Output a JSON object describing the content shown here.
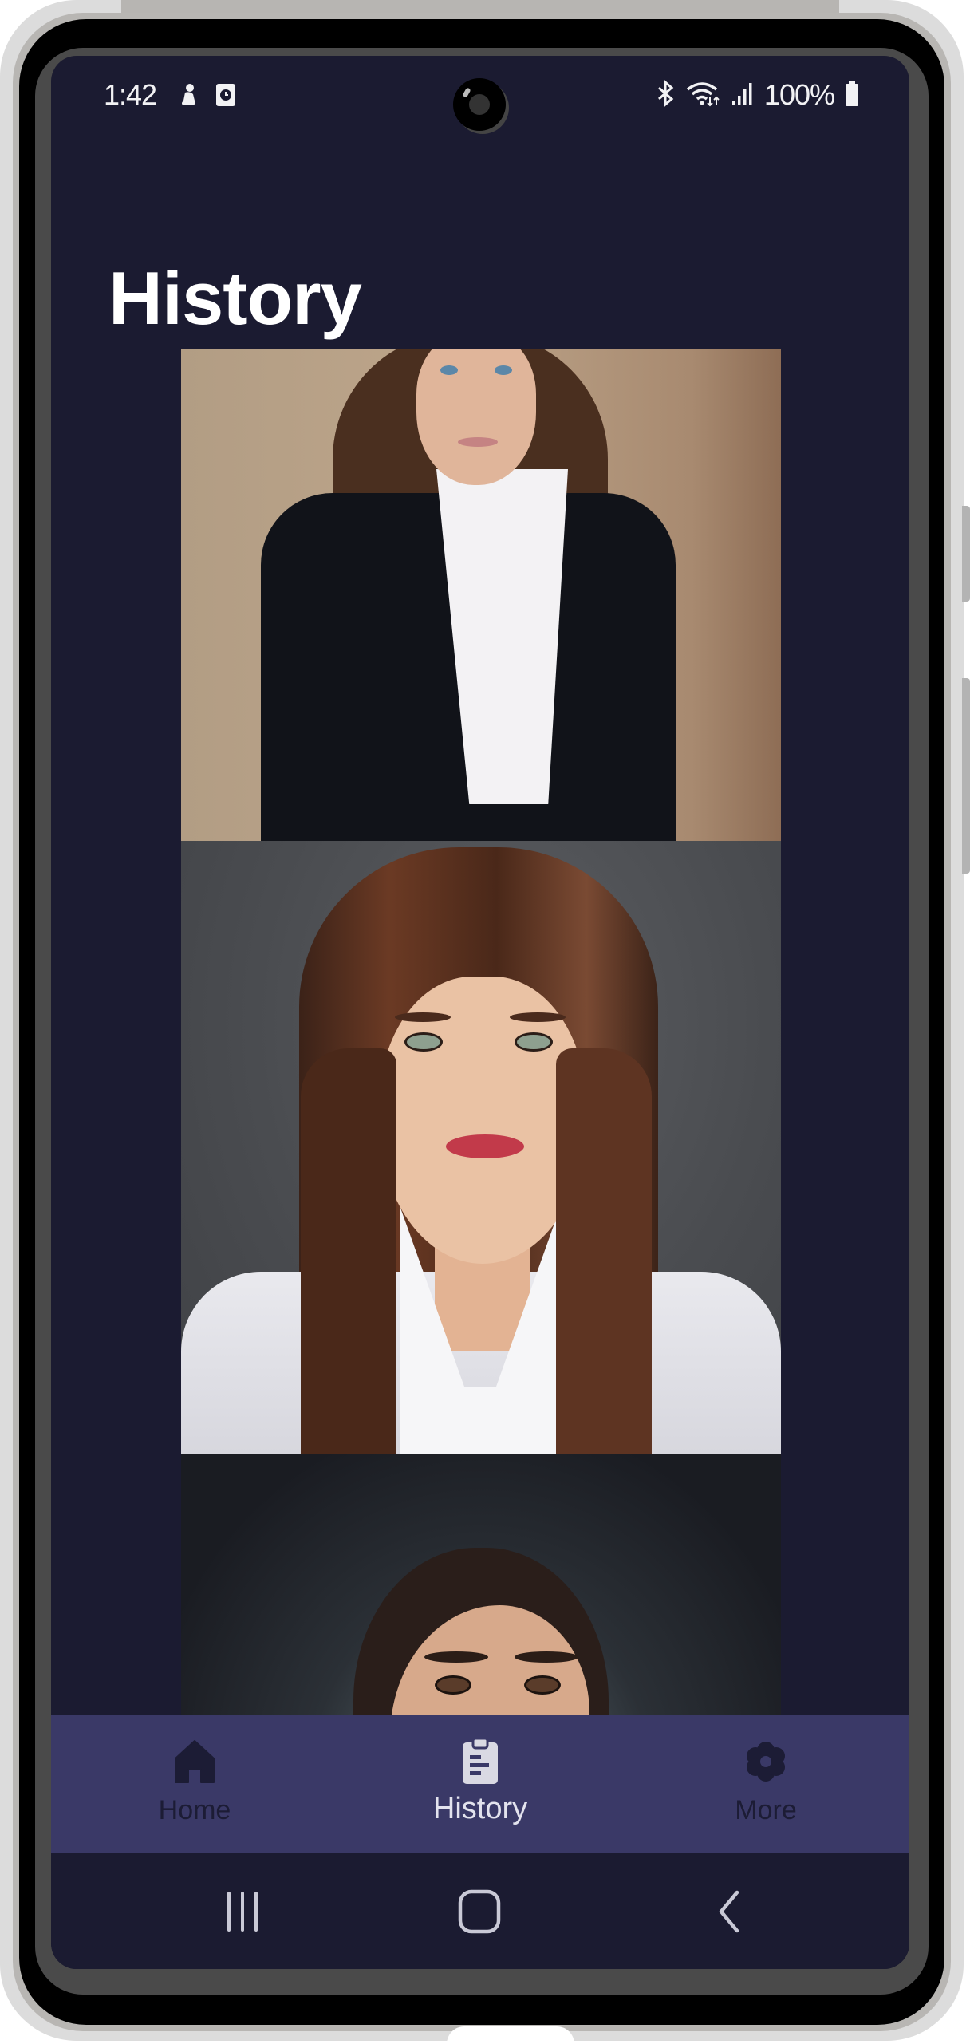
{
  "status_bar": {
    "time": "1:42",
    "left_icons": [
      "activity-notification-icon",
      "clock-app-icon"
    ],
    "right_icons": [
      "bluetooth-icon",
      "wifi-icon",
      "signal-icon",
      "battery-icon"
    ],
    "battery_percent": "100%"
  },
  "page": {
    "title": "History"
  },
  "history": {
    "items": [
      {
        "alt": "Generated portrait: woman with long brown wavy hair in black blazer and white shirt, beige background"
      },
      {
        "alt": "Generated portrait: woman with straight brown hair, red lips, white blazer, gray background"
      },
      {
        "alt": "Generated portrait: woman with dark hair pulled back, dark background (partially visible)"
      }
    ]
  },
  "bottom_nav": {
    "items": [
      {
        "label": "Home",
        "icon": "home-icon",
        "active": false
      },
      {
        "label": "History",
        "icon": "clipboard-icon",
        "active": true
      },
      {
        "label": "More",
        "icon": "gear-icon",
        "active": false
      }
    ]
  },
  "system_nav": {
    "buttons": [
      "recents",
      "home",
      "back"
    ]
  },
  "colors": {
    "background": "#1b1b31",
    "nav_bar": "#3a3967",
    "active_label": "#e3e3ee",
    "inactive_label": "#1c1c35",
    "title": "#ffffff"
  }
}
